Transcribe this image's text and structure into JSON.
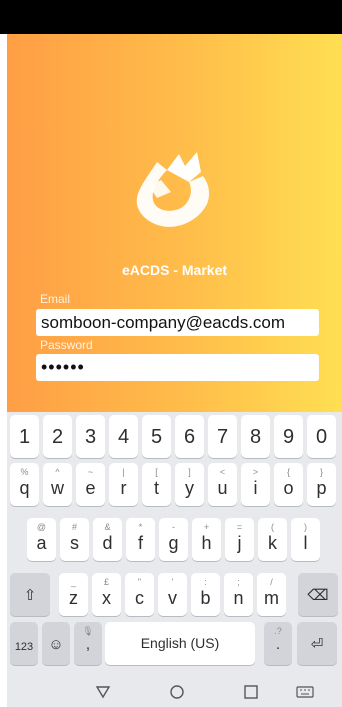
{
  "app": {
    "brand": "eACDS - Market"
  },
  "login": {
    "email_label": "Email",
    "email_value": "somboon-company@eacds.com",
    "password_label": "Password",
    "password_value": "••••••"
  },
  "keyboard": {
    "row_numbers": [
      "1",
      "2",
      "3",
      "4",
      "5",
      "6",
      "7",
      "8",
      "9",
      "0"
    ],
    "row1": [
      {
        "k": "q",
        "a": "%"
      },
      {
        "k": "w",
        "a": "^"
      },
      {
        "k": "e",
        "a": "~"
      },
      {
        "k": "r",
        "a": "|"
      },
      {
        "k": "t",
        "a": "["
      },
      {
        "k": "y",
        "a": "]"
      },
      {
        "k": "u",
        "a": "<"
      },
      {
        "k": "i",
        "a": ">"
      },
      {
        "k": "o",
        "a": "{"
      },
      {
        "k": "p",
        "a": "}"
      }
    ],
    "row2": [
      {
        "k": "a",
        "a": "@"
      },
      {
        "k": "s",
        "a": "#"
      },
      {
        "k": "d",
        "a": "&"
      },
      {
        "k": "f",
        "a": "*"
      },
      {
        "k": "g",
        "a": "-"
      },
      {
        "k": "h",
        "a": "+"
      },
      {
        "k": "j",
        "a": "="
      },
      {
        "k": "k",
        "a": "("
      },
      {
        "k": "l",
        "a": ")"
      }
    ],
    "row3": [
      {
        "k": "z",
        "a": "_"
      },
      {
        "k": "x",
        "a": "£"
      },
      {
        "k": "c",
        "a": "\""
      },
      {
        "k": "v",
        "a": "'"
      },
      {
        "k": "b",
        "a": ":"
      },
      {
        "k": "n",
        "a": ";"
      },
      {
        "k": "m",
        "a": "/"
      }
    ],
    "numbers_key": "123",
    "comma_key": ",",
    "period_key": ".",
    "space_label": "English (US)",
    "accent_color": "#ff9e45"
  }
}
